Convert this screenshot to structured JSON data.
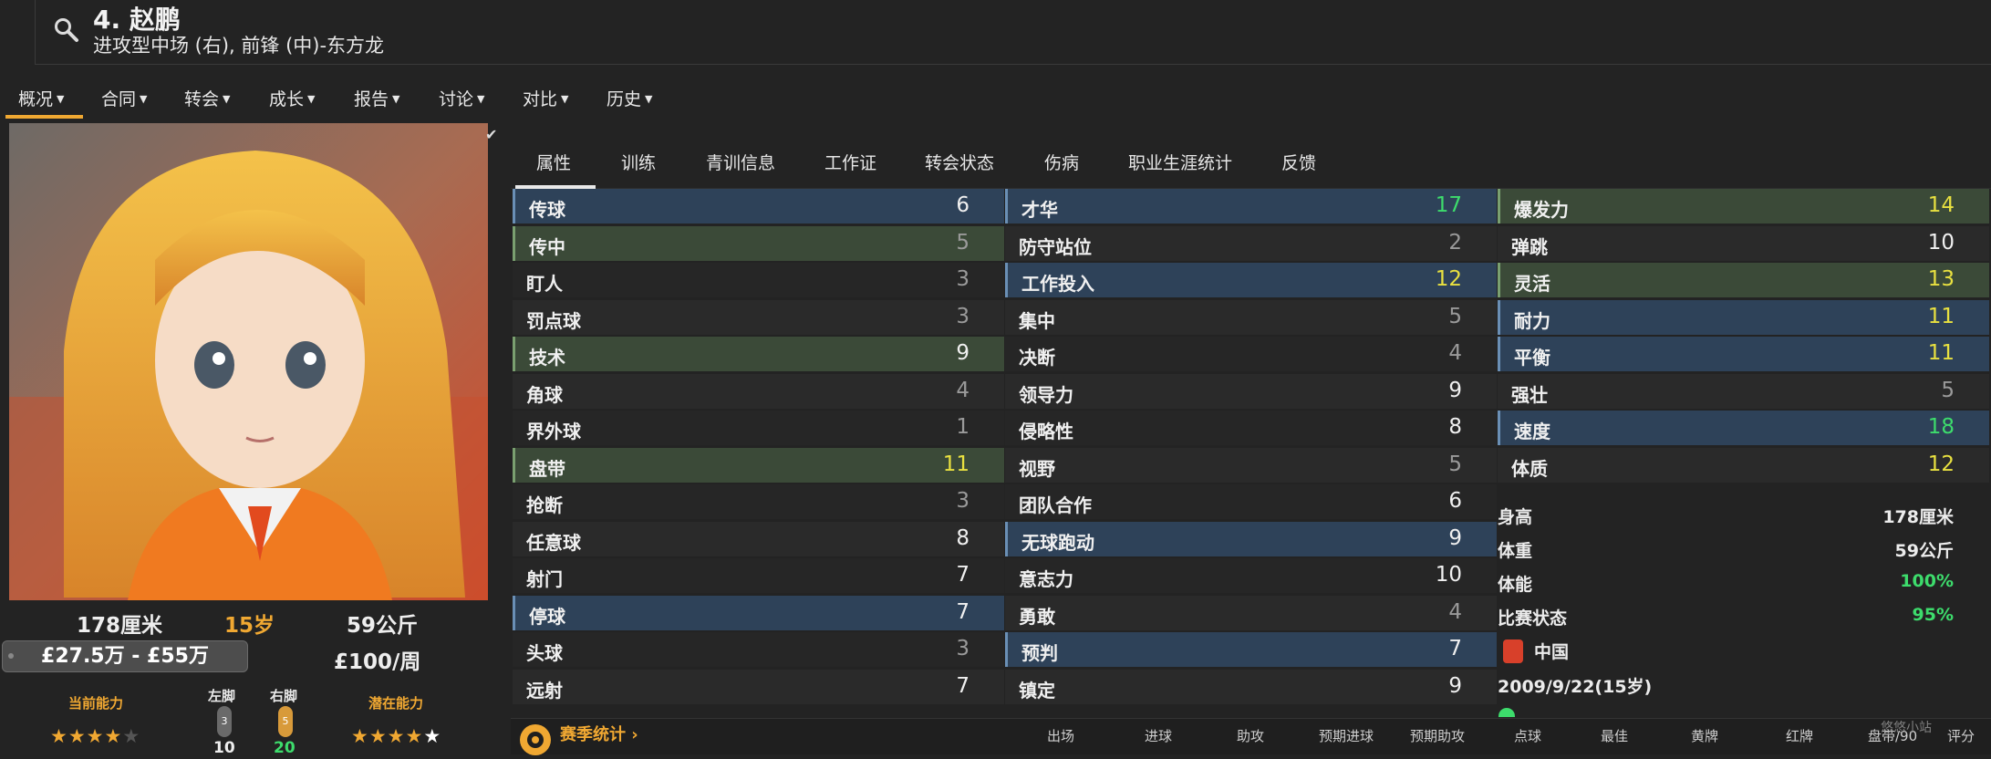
{
  "header": {
    "name": "4. 赵鹏",
    "role": "进攻型中场 (右), 前锋 (中)-东方龙"
  },
  "main_nav": [
    "概况",
    "合同",
    "转会",
    "成长",
    "报告",
    "讨论",
    "对比",
    "历史"
  ],
  "tabs": [
    "属性",
    "训练",
    "青训信息",
    "工作证",
    "转会状态",
    "伤病",
    "职业生涯统计",
    "反馈"
  ],
  "bio": {
    "height": "178厘米",
    "age": "15岁",
    "weight": "59公斤",
    "value": "£27.5万 - £55万",
    "wage": "£100/周",
    "current_ability_label": "当前能力",
    "potential_label": "潜在能力",
    "left_foot_label": "左脚",
    "right_foot_label": "右脚",
    "left_foot_badge": "3",
    "right_foot_badge": "5",
    "left_foot_value": "10",
    "right_foot_value": "20",
    "current_stars": 4,
    "potential_stars": 5
  },
  "technical": [
    {
      "label": "传球",
      "value": "6",
      "hl": "blue"
    },
    {
      "label": "传中",
      "value": "5",
      "hl": "green"
    },
    {
      "label": "盯人",
      "value": "3",
      "hl": ""
    },
    {
      "label": "罚点球",
      "value": "3",
      "hl": ""
    },
    {
      "label": "技术",
      "value": "9",
      "hl": "green"
    },
    {
      "label": "角球",
      "value": "4",
      "hl": ""
    },
    {
      "label": "界外球",
      "value": "1",
      "hl": ""
    },
    {
      "label": "盘带",
      "value": "11",
      "hl": "green"
    },
    {
      "label": "抢断",
      "value": "3",
      "hl": ""
    },
    {
      "label": "任意球",
      "value": "8",
      "hl": ""
    },
    {
      "label": "射门",
      "value": "7",
      "hl": ""
    },
    {
      "label": "停球",
      "value": "7",
      "hl": "blue"
    },
    {
      "label": "头球",
      "value": "3",
      "hl": ""
    },
    {
      "label": "远射",
      "value": "7",
      "hl": ""
    }
  ],
  "mental": [
    {
      "label": "才华",
      "value": "17",
      "hl": "blue"
    },
    {
      "label": "防守站位",
      "value": "2",
      "hl": ""
    },
    {
      "label": "工作投入",
      "value": "12",
      "hl": "blue"
    },
    {
      "label": "集中",
      "value": "5",
      "hl": ""
    },
    {
      "label": "决断",
      "value": "4",
      "hl": ""
    },
    {
      "label": "领导力",
      "value": "9",
      "hl": ""
    },
    {
      "label": "侵略性",
      "value": "8",
      "hl": ""
    },
    {
      "label": "视野",
      "value": "5",
      "hl": ""
    },
    {
      "label": "团队合作",
      "value": "6",
      "hl": ""
    },
    {
      "label": "无球跑动",
      "value": "9",
      "hl": "blue"
    },
    {
      "label": "意志力",
      "value": "10",
      "hl": ""
    },
    {
      "label": "勇敢",
      "value": "4",
      "hl": ""
    },
    {
      "label": "预判",
      "value": "7",
      "hl": "blue"
    },
    {
      "label": "镇定",
      "value": "9",
      "hl": ""
    }
  ],
  "physical": [
    {
      "label": "爆发力",
      "value": "14",
      "hl": "green"
    },
    {
      "label": "弹跳",
      "value": "10",
      "hl": ""
    },
    {
      "label": "灵活",
      "value": "13",
      "hl": "green"
    },
    {
      "label": "耐力",
      "value": "11",
      "hl": "blue"
    },
    {
      "label": "平衡",
      "value": "11",
      "hl": "blue"
    },
    {
      "label": "强壮",
      "value": "5",
      "hl": ""
    },
    {
      "label": "速度",
      "value": "18",
      "hl": "blue"
    },
    {
      "label": "体质",
      "value": "12",
      "hl": ""
    }
  ],
  "info": [
    {
      "label": "身高",
      "value": "178厘米"
    },
    {
      "label": "体重",
      "value": "59公斤"
    },
    {
      "label": "体能",
      "value": "100%"
    },
    {
      "label": "比赛状态",
      "value": "95%"
    }
  ],
  "nationality": "中国",
  "birth": "2009/9/22(15岁)",
  "season": {
    "label": "赛季统计",
    "columns": [
      "出场",
      "进球",
      "助攻",
      "预期进球",
      "预期助攻",
      "点球",
      "最佳",
      "黄牌",
      "红牌",
      "盘带/90",
      "评分"
    ]
  },
  "watermark": "悠悠小站",
  "colors": {
    "accent": "#f0a832",
    "val_white": "#f0f0f0",
    "val_grey": "#9a9a9a",
    "val_yellow": "#e8e040",
    "val_green": "#3ddc6c"
  }
}
